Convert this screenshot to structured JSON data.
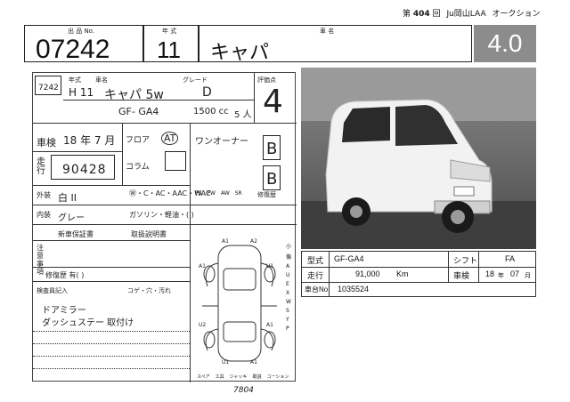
{
  "header": {
    "session_prefix": "第",
    "session_no": "404",
    "session_suffix": "回",
    "venue": "Ju岡山LAA",
    "auction": "オークション"
  },
  "top_labels": {
    "lot_label": "出 品 No.",
    "year_label": "年 式",
    "model_label": "車 名"
  },
  "lot_number": "07242",
  "model_year": "11",
  "model_name": "キャパ",
  "grade_score": "4.0",
  "sheet": {
    "stock_label": "7242",
    "year_small_label": "年式",
    "car_small_label": "車名",
    "grade_small_label": "グレード",
    "score_label": "評価点",
    "era_value": "H 11",
    "name_value": "キャパ 5w",
    "grade_value": "D",
    "chassis_value": "GF- GA4",
    "cc_value": "1500 cc",
    "seats_value": "5 人",
    "score_value": "4",
    "shaken_label": "車検",
    "shaken_value": "18 年 7 月",
    "mileage_label": "走行",
    "mileage_value": "90428",
    "floor_label": "フロア",
    "column_label": "コラム",
    "at_value": "AT",
    "owner_value": "ワンオーナー",
    "interior_score": "B",
    "exterior_score": "B",
    "color_label": "外装",
    "color_value": "白 II",
    "int_color_label": "内装",
    "int_color_value": "グレー",
    "equip_row": "Ⓦ・C・AC・AAC・WAC",
    "fuel_row": "ガソリン・軽油・( )",
    "ps_labels": [
      "PS",
      "PW",
      "AW",
      "SR"
    ],
    "history_label": "修復歴",
    "cert_label": "新車保証書",
    "manual_label": "取扱説明書",
    "note_label": "注意事項",
    "repair_label": "修復歴 有( )",
    "inspect_label": "検査員記入",
    "inspect_marks": "コゲ・穴・汚れ",
    "note1": "ドアミラー",
    "note2": "ダッシュステー 取付け",
    "signature": "7804",
    "side_legend": [
      "小",
      "傷",
      "A",
      "U",
      "E",
      "X",
      "W",
      "S",
      "Y",
      "P"
    ],
    "diagram_marks": [
      "A1",
      "A2",
      "A1",
      "U1",
      "U2",
      "A1",
      "U1",
      "A1"
    ],
    "bottom_legend": [
      "スペア",
      "工具",
      "ジャッキ",
      "取説",
      "コーション"
    ]
  },
  "table": {
    "model_label": "型式",
    "model_value": "GF-GA4",
    "shift_label": "シフト",
    "shift_value": "FA",
    "mileage_label": "走行",
    "mileage_value": "91,000",
    "mileage_unit": "Km",
    "shaken_label": "車検",
    "shaken_year": "18",
    "year_unit": "年",
    "shaken_month": "07",
    "month_unit": "月",
    "chassis_label": "車台No.",
    "chassis_value": "1035524"
  },
  "colors": {
    "grade_bg": "#8c8c8c",
    "photo_bg": "#6a6a6a",
    "car_body": "#f2f2f2"
  }
}
